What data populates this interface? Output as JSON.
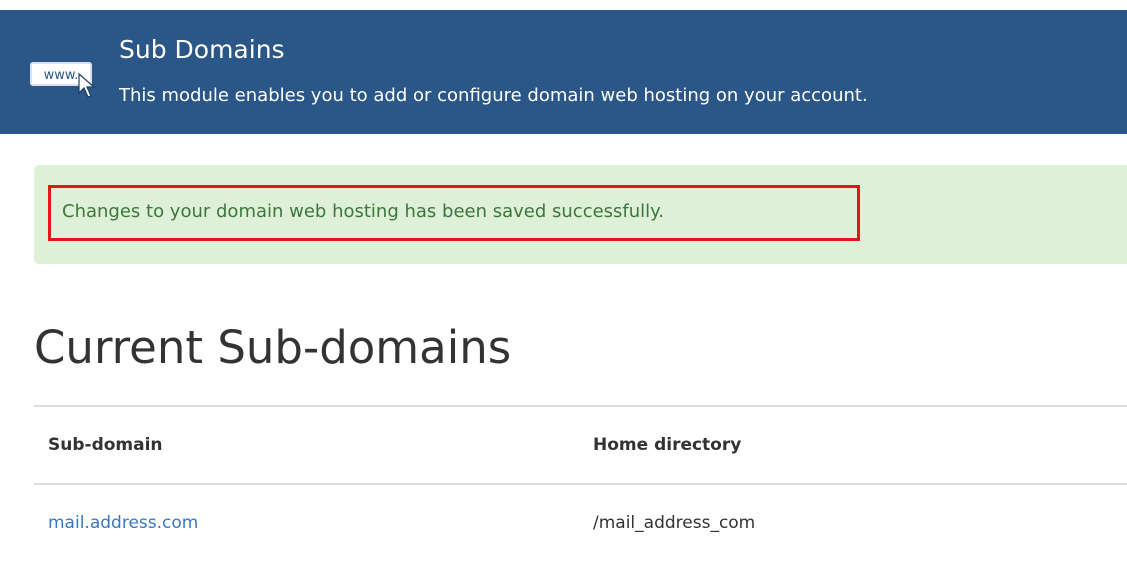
{
  "module": {
    "title": "Sub Domains",
    "description": "This module enables you to add or configure domain web hosting on your account.",
    "icon": "www-cursor-icon",
    "icon_text": "www.",
    "header_color": "#2b5688"
  },
  "alert": {
    "message": "Changes to your domain web hosting has been saved successfully.",
    "type": "success",
    "background_color": "#dff0d8",
    "text_color": "#3c763d",
    "highlight_color": "#e3161c"
  },
  "section": {
    "title": "Current Sub-domains"
  },
  "table": {
    "columns": [
      "Sub-domain",
      "Home directory"
    ],
    "rows": [
      {
        "subdomain": "mail.address.com",
        "home_directory": "/mail_address_com"
      }
    ],
    "link_color": "#3a77bf"
  }
}
